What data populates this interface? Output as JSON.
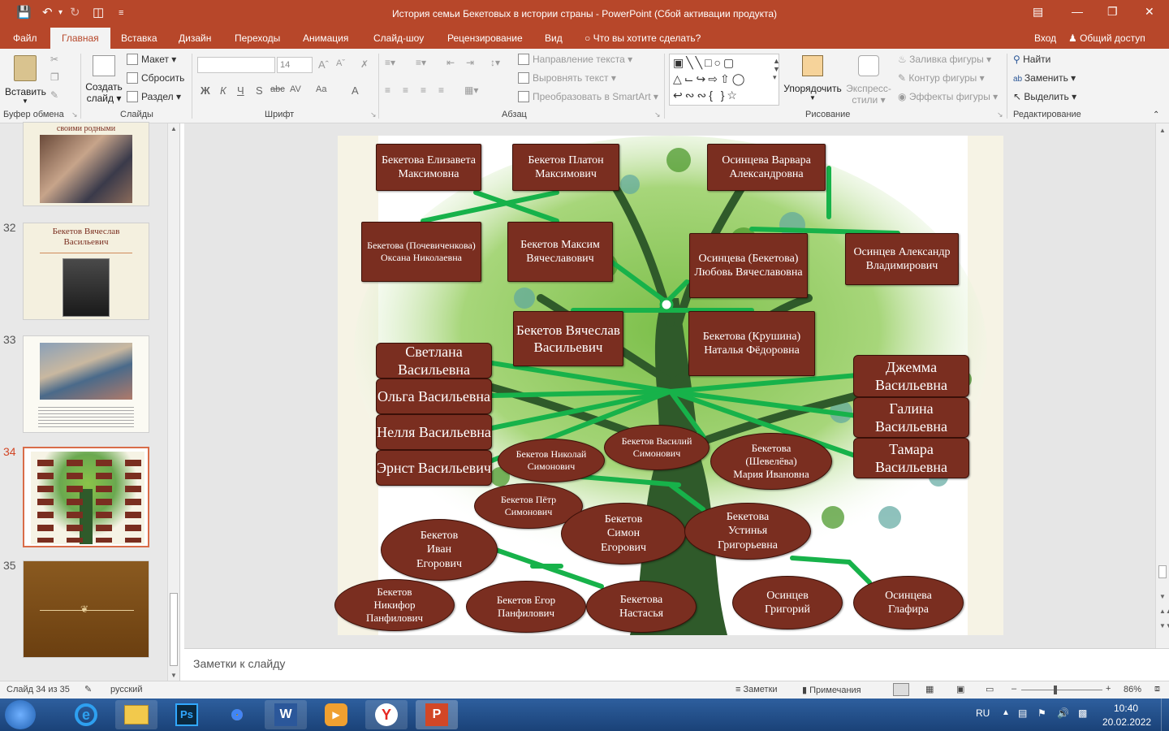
{
  "window": {
    "title": "История семьи Бекетовых в истории страны - PowerPoint (Сбой активации продукта)"
  },
  "ribbon_tabs": [
    "Файл",
    "Главная",
    "Вставка",
    "Дизайн",
    "Переходы",
    "Анимация",
    "Слайд-шоу",
    "Рецензирование",
    "Вид"
  ],
  "tell_me": "Что вы хотите сделать?",
  "signin": "Вход",
  "share": "Общий доступ",
  "clipboard": {
    "paste": "Вставить",
    "group": "Буфер обмена"
  },
  "slides_group": {
    "create": "Создать",
    "create2": "слайд",
    "layout": "Макет",
    "reset": "Сбросить",
    "section": "Раздел",
    "group": "Слайды"
  },
  "font_group": {
    "size": "14",
    "group": "Шрифт",
    "b": "Ж",
    "i": "К",
    "u": "Ч",
    "s": "S",
    "abc": "abc",
    "av": "AV",
    "aa": "Aa",
    "a": "A"
  },
  "paragraph_group": {
    "direction": "Направление текста",
    "align": "Выровнять текст",
    "smartart": "Преобразовать в SmartArt",
    "group": "Абзац"
  },
  "drawing_group": {
    "arrange": "Упорядочить",
    "quick": "Экспресс-",
    "quick2": "стили",
    "fill": "Заливка фигуры",
    "outline": "Контур фигуры",
    "effects": "Эффекты фигуры",
    "group": "Рисование"
  },
  "editing_group": {
    "find": "Найти",
    "replace": "Заменить",
    "select": "Выделить",
    "group": "Редактирование"
  },
  "thumbnails": [
    {
      "num": "",
      "caption": "своими родными"
    },
    {
      "num": "32",
      "caption": "Бекетов Вячеслав Васильевич"
    },
    {
      "num": "33",
      "caption": ""
    },
    {
      "num": "34",
      "caption": ""
    },
    {
      "num": "35",
      "caption": ""
    }
  ],
  "tree": {
    "boxes": [
      {
        "text": "Бекетова Елизавета Максимовна"
      },
      {
        "text": "Бекетов Платон Максимович"
      },
      {
        "text": "Осинцева Варвара Александровна"
      },
      {
        "text": "Бекетова (Почевиченкова) Оксана Николаевна"
      },
      {
        "text": "Бекетов Максим Вячеславович"
      },
      {
        "text": "Осинцева (Бекетова) Любовь Вячеславовна"
      },
      {
        "text": "Осинцев Александр Владимирович"
      },
      {
        "text": "Бекетов Вячеслав Васильевич"
      },
      {
        "text": "Бекетова (Крушина) Наталья Фёдоровна"
      },
      {
        "text": "Светлана Васильевна"
      },
      {
        "text": "Ольга Васильевна"
      },
      {
        "text": "Нелля Васильевна"
      },
      {
        "text": "Эрнст Васильевич"
      },
      {
        "text": "Джемма Васильевна"
      },
      {
        "text": "Галина Васильевна"
      },
      {
        "text": "Тамара Васильевна"
      }
    ],
    "ovals": [
      {
        "text": "Бекетов Николай Симонович"
      },
      {
        "text": "Бекетов Василий Симонович"
      },
      {
        "text": "Бекетова (Шевелёва) Мария Ивановна"
      },
      {
        "text": "Бекетов Пётр Симонович"
      },
      {
        "text": "Бекетов Иван Егорович"
      },
      {
        "text": "Бекетов Симон Егорович"
      },
      {
        "text": "Бекетова Устинья Григорьевна"
      },
      {
        "text": "Бекетов Никифор Панфилович"
      },
      {
        "text": "Бекетов Егор Панфилович"
      },
      {
        "text": "Бекетова Настасья"
      },
      {
        "text": "Осинцев Григорий"
      },
      {
        "text": "Осинцева Глафира"
      }
    ]
  },
  "notes_placeholder": "Заметки к слайду",
  "status": {
    "slide": "Слайд 34 из 35",
    "lang": "русский",
    "notes": "Заметки",
    "comments": "Примечания",
    "zoom": "86%"
  },
  "taskbar": {
    "lang": "RU",
    "time": "10:40",
    "date": "20.02.2022"
  },
  "colors": {
    "accent": "#b7472a",
    "box": "#7a2e20",
    "connector": "#17b24a",
    "trunk": "#2f5a2a"
  }
}
